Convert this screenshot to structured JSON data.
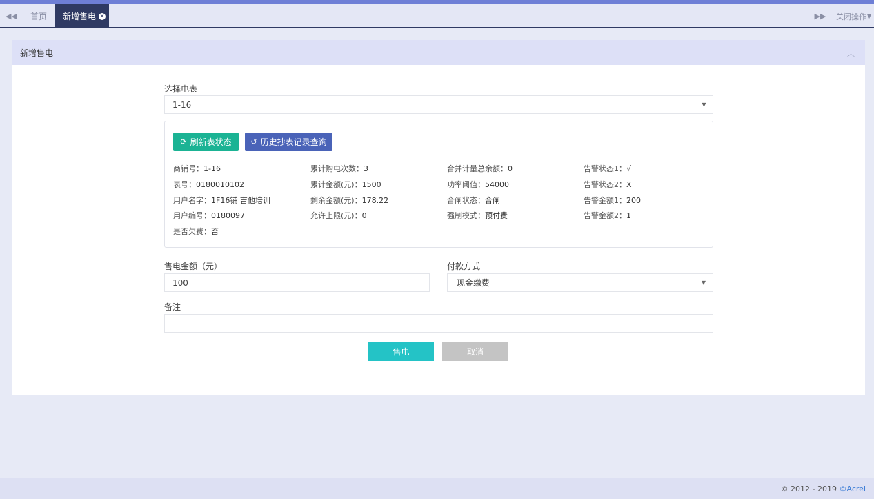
{
  "tabs": {
    "prev_icon": "double-chevron-left-icon",
    "home": "首页",
    "active": "新增售电",
    "active_close_icon": "close-circle-icon",
    "next_icon": "double-chevron-right-icon",
    "close_ops": "关闭操作"
  },
  "panel": {
    "title": "新增售电",
    "meter_label": "选择电表",
    "meter_value": "1-16",
    "refresh_button": "刷新表状态",
    "history_button": "历史抄表记录查询",
    "info": {
      "col1": [
        {
          "label": "商铺号：",
          "value": "1-16"
        },
        {
          "label": "表号：",
          "value": "0180010102"
        },
        {
          "label": "用户名字：",
          "value": "1F16铺 吉他培训"
        },
        {
          "label": "用户编号：",
          "value": "0180097"
        },
        {
          "label": "是否欠费：",
          "value": "否"
        }
      ],
      "col2": [
        {
          "label": "累计购电次数：",
          "value": "3"
        },
        {
          "label": "累计金额(元)：",
          "value": "1500"
        },
        {
          "label": "剩余金额(元)：",
          "value": "178.22"
        },
        {
          "label": "允许上限(元)：",
          "value": "0"
        }
      ],
      "col3": [
        {
          "label": "合并计量总余额：",
          "value": "0"
        },
        {
          "label": "功率阈值：",
          "value": "54000"
        },
        {
          "label": "合闸状态：",
          "value": "合闸"
        },
        {
          "label": "强制模式：",
          "value": "预付费"
        }
      ],
      "col4": [
        {
          "label": "告警状态1：",
          "value": "√"
        },
        {
          "label": "告警状态2：",
          "value": "X"
        },
        {
          "label": "告警金额1：",
          "value": "200"
        },
        {
          "label": "告警金额2：",
          "value": "1"
        }
      ]
    },
    "amount_label": "售电金额（元）",
    "amount_value": "100",
    "payment_label": "付款方式",
    "payment_value": "现金缴费",
    "remark_label": "备注",
    "remark_value": "",
    "sell_button": "售电",
    "cancel_button": "取消"
  },
  "footer": {
    "copyright": "© 2012 - 2019 ",
    "brand": "©Acrel"
  }
}
